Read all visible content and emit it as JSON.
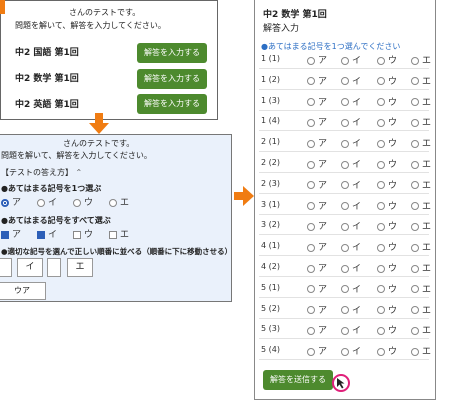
{
  "top_panel": {
    "intro_line1": "さんのテストです。",
    "intro_line2": "問題を解いて、解答を入力してください。",
    "tests": [
      {
        "name": "中2 国語 第1回",
        "button": "解答を入力する"
      },
      {
        "name": "中2 数学 第1回",
        "button": "解答を入力する"
      },
      {
        "name": "中2 英語 第1回",
        "button": "解答を入力する"
      }
    ]
  },
  "guide_panel": {
    "intro_line1": "さんのテストです。",
    "intro_line2": "問題を解いて、解答を入力してください。",
    "howto_title": "【テストの答え方】",
    "howto_toggle": "⌃",
    "single": {
      "label": "●あてはまる記号を1つ選ぶ",
      "options": [
        "ア",
        "イ",
        "ウ",
        "エ"
      ],
      "selected": "ア"
    },
    "multi": {
      "label": "●あてはまる記号をすべて選ぶ",
      "options": [
        "ア",
        "イ",
        "ウ",
        "エ"
      ],
      "checked": [
        "ア",
        "イ"
      ]
    },
    "order": {
      "label": "●適切な記号を選んで正しい順番に並べる（順番に下に移動させる）",
      "boxes": [
        "",
        "イ",
        "",
        "エ"
      ],
      "result": "ウア"
    }
  },
  "answer_panel": {
    "title": "中2 数学 第1回",
    "subtitle": "解答入力",
    "instruction": "●あてはまる記号を1つ選んでください",
    "options": [
      "ア",
      "イ",
      "ウ",
      "エ"
    ],
    "questions": [
      "1 (1)",
      "1 (2)",
      "1 (3)",
      "1 (4)",
      "2 (1)",
      "2 (2)",
      "2 (3)",
      "3 (1)",
      "3 (2)",
      "4 (1)",
      "4 (2)",
      "5 (1)",
      "5 (2)",
      "5 (3)",
      "5 (4)"
    ],
    "submit": "解答を送信する"
  },
  "colors": {
    "button_green": "#4d8a2e",
    "arrow_orange": "#f07c12",
    "instruction_blue": "#2d6fc4",
    "cursor_highlight": "#e0207a"
  },
  "icons": {
    "down_arrow": "arrow-down-icon",
    "right_arrow": "arrow-right-icon",
    "cursor": "mouse-cursor-icon"
  }
}
